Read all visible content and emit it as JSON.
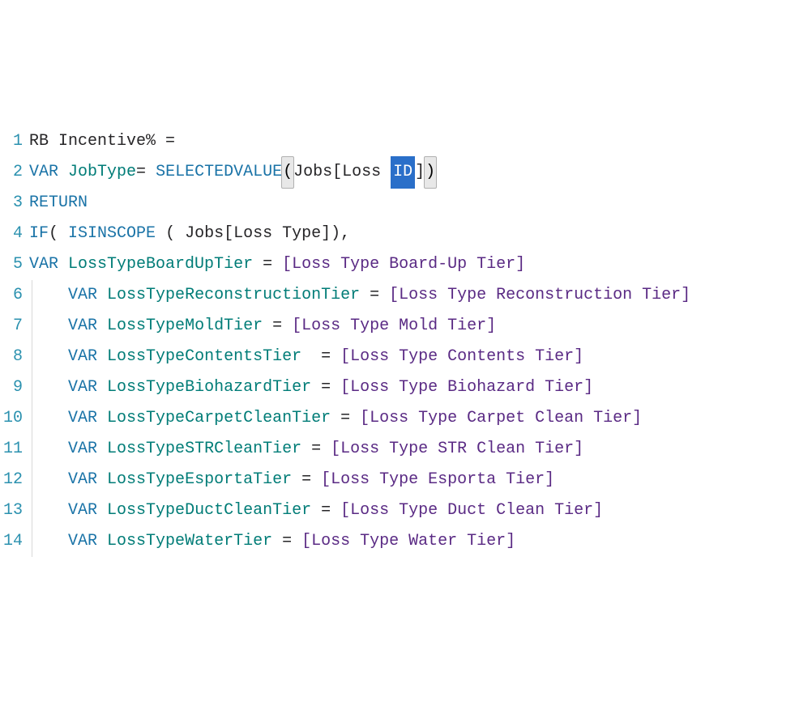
{
  "editor": {
    "lines": [
      {
        "num": "1",
        "tokens": [
          {
            "cls": "tok-plain",
            "text": "RB Incentive% ="
          }
        ]
      },
      {
        "num": "2",
        "tokens": [
          {
            "cls": "tok-var-keyword",
            "text": "VAR"
          },
          {
            "cls": "tok-plain",
            "text": " "
          },
          {
            "cls": "tok-varname",
            "text": "JobType"
          },
          {
            "cls": "tok-plain",
            "text": "= "
          },
          {
            "cls": "tok-func",
            "text": "SELECTEDVALUE"
          },
          {
            "cls": "tok-bracket-highlight",
            "text": "("
          },
          {
            "cls": "tok-plain",
            "text": "Jobs[Loss "
          },
          {
            "cls": "tok-selected",
            "text": "ID"
          },
          {
            "cls": "tok-plain",
            "text": "]"
          },
          {
            "cls": "tok-bracket-highlight",
            "text": ")"
          },
          {
            "cls": "tok-cursor",
            "text": "​"
          }
        ]
      },
      {
        "num": "3",
        "tokens": [
          {
            "cls": "tok-keyword",
            "text": "RETURN"
          }
        ]
      },
      {
        "num": "4",
        "tokens": [
          {
            "cls": "tok-func",
            "text": "IF"
          },
          {
            "cls": "tok-plain",
            "text": "( "
          },
          {
            "cls": "tok-func",
            "text": "ISINSCOPE"
          },
          {
            "cls": "tok-plain",
            "text": " ( Jobs[Loss Type]),"
          }
        ]
      },
      {
        "num": "5",
        "tokens": [
          {
            "cls": "tok-var-keyword",
            "text": "VAR"
          },
          {
            "cls": "tok-plain",
            "text": " "
          },
          {
            "cls": "tok-varname",
            "text": "LossTypeBoardUpTier"
          },
          {
            "cls": "tok-plain",
            "text": " = "
          },
          {
            "cls": "tok-measure",
            "text": "[Loss Type Board-Up Tier]"
          }
        ]
      },
      {
        "num": "6",
        "tokens": [
          {
            "cls": "indent-guide",
            "text": ""
          },
          {
            "cls": "tok-plain",
            "text": "    "
          },
          {
            "cls": "tok-var-keyword",
            "text": "VAR"
          },
          {
            "cls": "tok-plain",
            "text": " "
          },
          {
            "cls": "tok-varname",
            "text": "LossTypeReconstructionTier"
          },
          {
            "cls": "tok-plain",
            "text": " = "
          },
          {
            "cls": "tok-measure",
            "text": "[Loss Type Reconstruction Tier]"
          }
        ]
      },
      {
        "num": "7",
        "tokens": [
          {
            "cls": "indent-guide",
            "text": ""
          },
          {
            "cls": "tok-plain",
            "text": "    "
          },
          {
            "cls": "tok-var-keyword",
            "text": "VAR"
          },
          {
            "cls": "tok-plain",
            "text": " "
          },
          {
            "cls": "tok-varname",
            "text": "LossTypeMoldTier"
          },
          {
            "cls": "tok-plain",
            "text": " = "
          },
          {
            "cls": "tok-measure",
            "text": "[Loss Type Mold Tier]"
          }
        ]
      },
      {
        "num": "8",
        "tokens": [
          {
            "cls": "indent-guide",
            "text": ""
          },
          {
            "cls": "tok-plain",
            "text": "    "
          },
          {
            "cls": "tok-var-keyword",
            "text": "VAR"
          },
          {
            "cls": "tok-plain",
            "text": " "
          },
          {
            "cls": "tok-varname",
            "text": "LossTypeContentsTier"
          },
          {
            "cls": "tok-plain",
            "text": "  = "
          },
          {
            "cls": "tok-measure",
            "text": "[Loss Type Contents Tier]"
          }
        ]
      },
      {
        "num": "9",
        "tokens": [
          {
            "cls": "indent-guide",
            "text": ""
          },
          {
            "cls": "tok-plain",
            "text": "    "
          },
          {
            "cls": "tok-var-keyword",
            "text": "VAR"
          },
          {
            "cls": "tok-plain",
            "text": " "
          },
          {
            "cls": "tok-varname",
            "text": "LossTypeBiohazardTier"
          },
          {
            "cls": "tok-plain",
            "text": " = "
          },
          {
            "cls": "tok-measure",
            "text": "[Loss Type Biohazard Tier]"
          }
        ]
      },
      {
        "num": "10",
        "tokens": [
          {
            "cls": "indent-guide",
            "text": ""
          },
          {
            "cls": "tok-plain",
            "text": "    "
          },
          {
            "cls": "tok-var-keyword",
            "text": "VAR"
          },
          {
            "cls": "tok-plain",
            "text": " "
          },
          {
            "cls": "tok-varname",
            "text": "LossTypeCarpetCleanTier"
          },
          {
            "cls": "tok-plain",
            "text": " = "
          },
          {
            "cls": "tok-measure",
            "text": "[Loss Type Carpet Clean Tier]"
          }
        ]
      },
      {
        "num": "11",
        "tokens": [
          {
            "cls": "indent-guide",
            "text": ""
          },
          {
            "cls": "tok-plain",
            "text": "    "
          },
          {
            "cls": "tok-var-keyword",
            "text": "VAR"
          },
          {
            "cls": "tok-plain",
            "text": " "
          },
          {
            "cls": "tok-varname",
            "text": "LossTypeSTRCleanTier"
          },
          {
            "cls": "tok-plain",
            "text": " = "
          },
          {
            "cls": "tok-measure",
            "text": "[Loss Type STR Clean Tier]"
          }
        ]
      },
      {
        "num": "12",
        "tokens": [
          {
            "cls": "indent-guide",
            "text": ""
          },
          {
            "cls": "tok-plain",
            "text": "    "
          },
          {
            "cls": "tok-var-keyword",
            "text": "VAR"
          },
          {
            "cls": "tok-plain",
            "text": " "
          },
          {
            "cls": "tok-varname",
            "text": "LossTypeEsportaTier"
          },
          {
            "cls": "tok-plain",
            "text": " = "
          },
          {
            "cls": "tok-measure",
            "text": "[Loss Type Esporta Tier]"
          }
        ]
      },
      {
        "num": "13",
        "tokens": [
          {
            "cls": "indent-guide",
            "text": ""
          },
          {
            "cls": "tok-plain",
            "text": "    "
          },
          {
            "cls": "tok-var-keyword",
            "text": "VAR"
          },
          {
            "cls": "tok-plain",
            "text": " "
          },
          {
            "cls": "tok-varname",
            "text": "LossTypeDuctCleanTier"
          },
          {
            "cls": "tok-plain",
            "text": " = "
          },
          {
            "cls": "tok-measure",
            "text": "[Loss Type Duct Clean Tier]"
          }
        ]
      },
      {
        "num": "14",
        "tokens": [
          {
            "cls": "indent-guide",
            "text": ""
          },
          {
            "cls": "tok-plain",
            "text": "    "
          },
          {
            "cls": "tok-var-keyword",
            "text": "VAR"
          },
          {
            "cls": "tok-plain",
            "text": " "
          },
          {
            "cls": "tok-varname",
            "text": "LossTypeWaterTier"
          },
          {
            "cls": "tok-plain",
            "text": " = "
          },
          {
            "cls": "tok-measure",
            "text": "[Loss Type Water Tier]"
          }
        ]
      }
    ]
  },
  "colors": {
    "keyword": "#1a73a7",
    "varname": "#007c77",
    "measure": "#5a2a84",
    "plain": "#262527",
    "gutter": "#2b91af",
    "selection": "#2a6fc9"
  }
}
